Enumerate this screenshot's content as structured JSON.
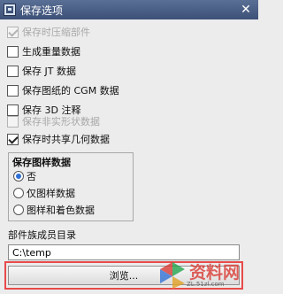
{
  "window": {
    "title": "保存选项",
    "close_glyph": "✕"
  },
  "options": [
    {
      "label": "保存时压缩部件",
      "checked": true,
      "disabled": true
    },
    {
      "label": "生成重量数据",
      "checked": false,
      "disabled": false
    },
    {
      "label": "保存 JT 数据",
      "checked": false,
      "disabled": false
    },
    {
      "label": "保存图纸的 CGM 数据",
      "checked": false,
      "disabled": false
    },
    {
      "label": "保存 3D 注释",
      "checked": false,
      "disabled": false
    },
    {
      "label": "保存非实形状数据",
      "checked": false,
      "disabled": true
    },
    {
      "label": "保存时共享几何数据",
      "checked": true,
      "disabled": false
    }
  ],
  "pattern_group": {
    "title": "保存图样数据",
    "choices": [
      "否",
      "仅图样数据",
      "图样和着色数据"
    ],
    "selected_index": 0
  },
  "member_directory": {
    "label": "部件族成员目录",
    "value": "C:\\temp"
  },
  "browse_button": {
    "label": "浏览..."
  },
  "watermark": {
    "text": "资料网",
    "url": "ZL.51zl.com"
  },
  "colors": {
    "titlebar": "#3d5178",
    "highlight": "#e84a4a",
    "watermark": "#d8362f"
  }
}
